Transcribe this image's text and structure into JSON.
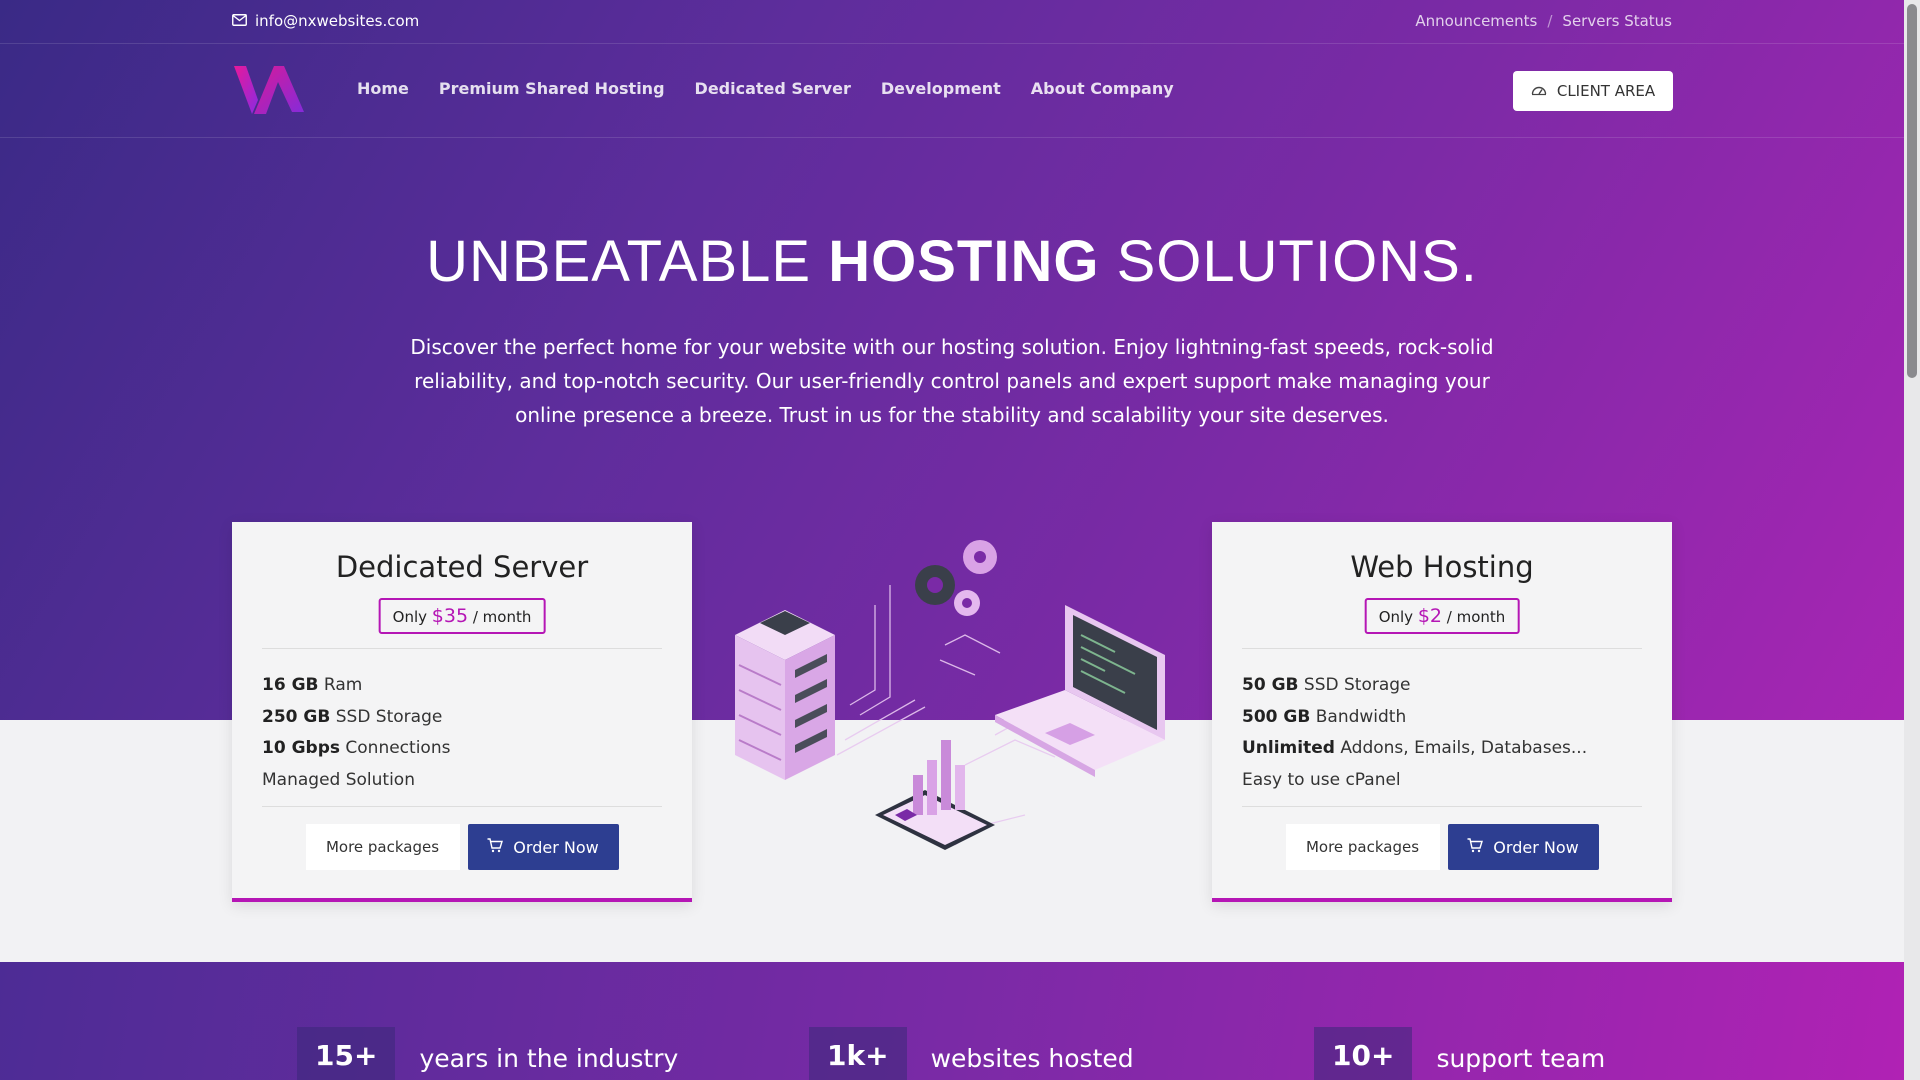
{
  "topbar": {
    "email": "info@nxwebsites.com",
    "links": [
      "Announcements",
      "Servers Status"
    ]
  },
  "nav": {
    "items": [
      "Home",
      "Premium Shared Hosting",
      "Dedicated Server",
      "Development",
      "About Company"
    ],
    "client_area": "CLIENT AREA"
  },
  "hero": {
    "title_light": "UNBEATABLE",
    "title_bold": "HOSTING",
    "title_end": "SOLUTIONS.",
    "description": "Discover the perfect home for your website with our hosting solution. Enjoy lightning-fast speeds, rock-solid reliability, and top-notch security. Our user-friendly control panels and expert support make managing your online presence a breeze. Trust in us for the stability and scalability your site deserves."
  },
  "cards": [
    {
      "title": "Dedicated Server",
      "price_prefix": "Only",
      "price": "$35",
      "price_suffix": "/ month",
      "features": [
        {
          "bold": "16 GB",
          "text": "Ram"
        },
        {
          "bold": "250 GB",
          "text": "SSD Storage"
        },
        {
          "bold": "10 Gbps",
          "text": "Connections"
        },
        {
          "bold": "",
          "text": "Managed Solution"
        }
      ],
      "more_label": "More packages",
      "order_label": "Order Now"
    },
    {
      "title": "Web Hosting",
      "price_prefix": "Only",
      "price": "$2",
      "price_suffix": "/ month",
      "features": [
        {
          "bold": "50 GB",
          "text": "SSD Storage"
        },
        {
          "bold": "500 GB",
          "text": "Bandwidth"
        },
        {
          "bold": "Unlimited",
          "text": "Addons, Emails, Databases..."
        },
        {
          "bold": "",
          "text": "Easy to use cPanel"
        }
      ],
      "more_label": "More packages",
      "order_label": "Order Now"
    }
  ],
  "stats": [
    {
      "num": "15+",
      "label": "years in the industry"
    },
    {
      "num": "1k+",
      "label": "websites hosted"
    },
    {
      "num": "10+",
      "label": "support team"
    }
  ],
  "colors": {
    "accent": "#b516b5",
    "order_button": "#2d3e91",
    "hero_start": "#3a2a86",
    "hero_end": "#a725b3"
  }
}
